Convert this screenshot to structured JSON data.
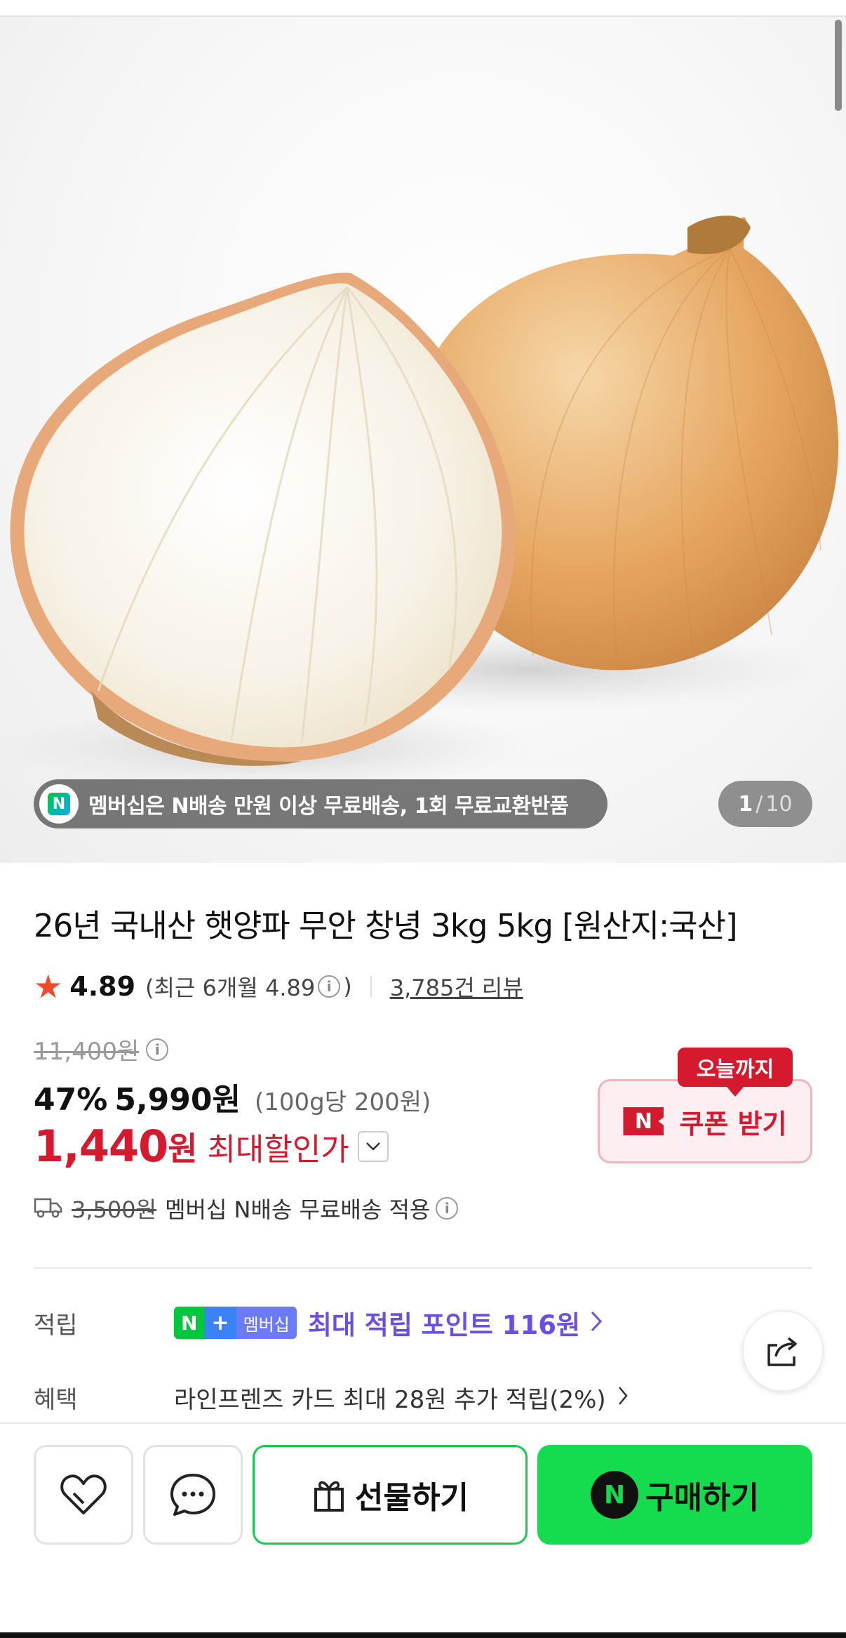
{
  "gallery": {
    "promo_text": "멤버십은 N배송 만원 이상 무료배송, 1회 무료교환반품",
    "promo_logo": "N",
    "counter_current": "1",
    "counter_sep": "/",
    "counter_total": "10"
  },
  "product": {
    "title": "26년 국내산 햇양파 무안 창녕 3kg 5kg [원산지:국산]",
    "rating": "4.89",
    "rating_recent": "(최근 6개월 4.89",
    "rating_recent_close": ")",
    "reviews": "3,785건 리뷰"
  },
  "price": {
    "original": "11,400원",
    "discount": "47%",
    "sale": "5,990원",
    "unit": "(100g당 200원)",
    "best_amount": "1,440",
    "best_won": "원",
    "best_label": "최대할인가"
  },
  "coupon": {
    "tag": "오늘까지",
    "logo": "N",
    "label": "쿠폰 받기"
  },
  "shipping": {
    "original_fee": "3,500원",
    "text": "멤버십 N배송 무료배송 적용"
  },
  "points": {
    "label": "적립",
    "badge_n": "N",
    "badge_plus": "+",
    "badge_membership": "멤버십",
    "text": "최대 적립 포인트 116원"
  },
  "benefit": {
    "label": "혜택",
    "text": "라인프렌즈 카드 최대 28원 추가 적립(2%)"
  },
  "actions": {
    "gift_label": "선물하기",
    "buy_logo": "N",
    "buy_label": "구매하기"
  },
  "colors": {
    "discount_red": "#d51a2f",
    "naver_green": "#15db4e",
    "points_purple": "#6b4ee6",
    "star": "#f04a2c"
  }
}
